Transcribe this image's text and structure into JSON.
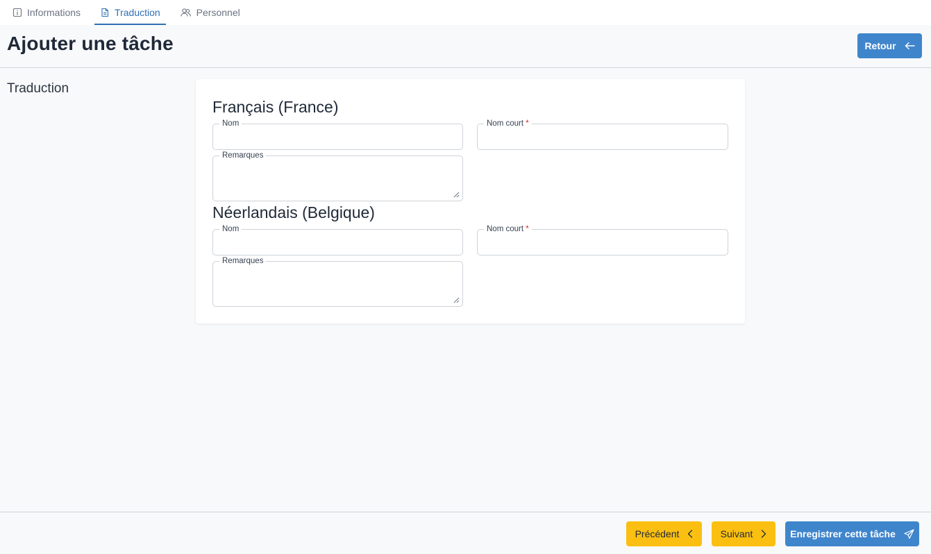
{
  "tabs": [
    {
      "label": "Informations",
      "icon": "info-icon",
      "active": false
    },
    {
      "label": "Traduction",
      "icon": "document-icon",
      "active": true
    },
    {
      "label": "Personnel",
      "icon": "users-icon",
      "active": false
    }
  ],
  "header": {
    "title": "Ajouter une tâche",
    "back_label": "Retour"
  },
  "section": {
    "label": "Traduction"
  },
  "languages": [
    {
      "title": "Français (France)",
      "name_label": "Nom",
      "name_value": "",
      "short_name_label": "Nom court",
      "short_name_value": "",
      "remarks_label": "Remarques",
      "remarks_value": ""
    },
    {
      "title": "Néerlandais (Belgique)",
      "name_label": "Nom",
      "name_value": "",
      "short_name_label": "Nom court",
      "short_name_value": "",
      "remarks_label": "Remarques",
      "remarks_value": ""
    }
  ],
  "required_marker": "*",
  "footer": {
    "previous_label": "Précédent",
    "next_label": "Suivant",
    "save_label": "Enregistrer cette tâche"
  },
  "colors": {
    "primary": "#3f85cc",
    "warning": "#fbbf11",
    "active_tab": "#2f6fb3",
    "required": "#dc2626"
  }
}
